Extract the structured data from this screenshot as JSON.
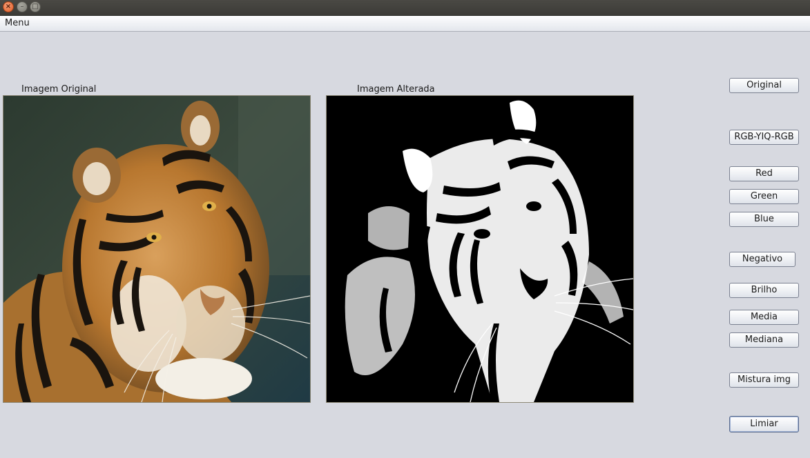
{
  "window": {
    "close_glyph": "×",
    "minimize_glyph": "–",
    "maximize_glyph": "□"
  },
  "menubar": {
    "menu_label": "Menu"
  },
  "labels": {
    "original": "Imagem Original",
    "altered": "Imagem Alterada"
  },
  "buttons": {
    "original": "Original",
    "rgb_yiq_rgb": "RGB-YIQ-RGB",
    "red": "Red",
    "green": "Green",
    "blue": "Blue",
    "negativo": "Negativo",
    "brilho": "Brilho",
    "media": "Media",
    "mediana": "Mediana",
    "mistura": "Mistura img",
    "limiar": "Limiar"
  },
  "colors": {
    "window_bg": "#d7d9e0",
    "accent_close": "#e25a22"
  },
  "icons": [
    "close-icon",
    "minimize-icon",
    "maximize-icon"
  ]
}
